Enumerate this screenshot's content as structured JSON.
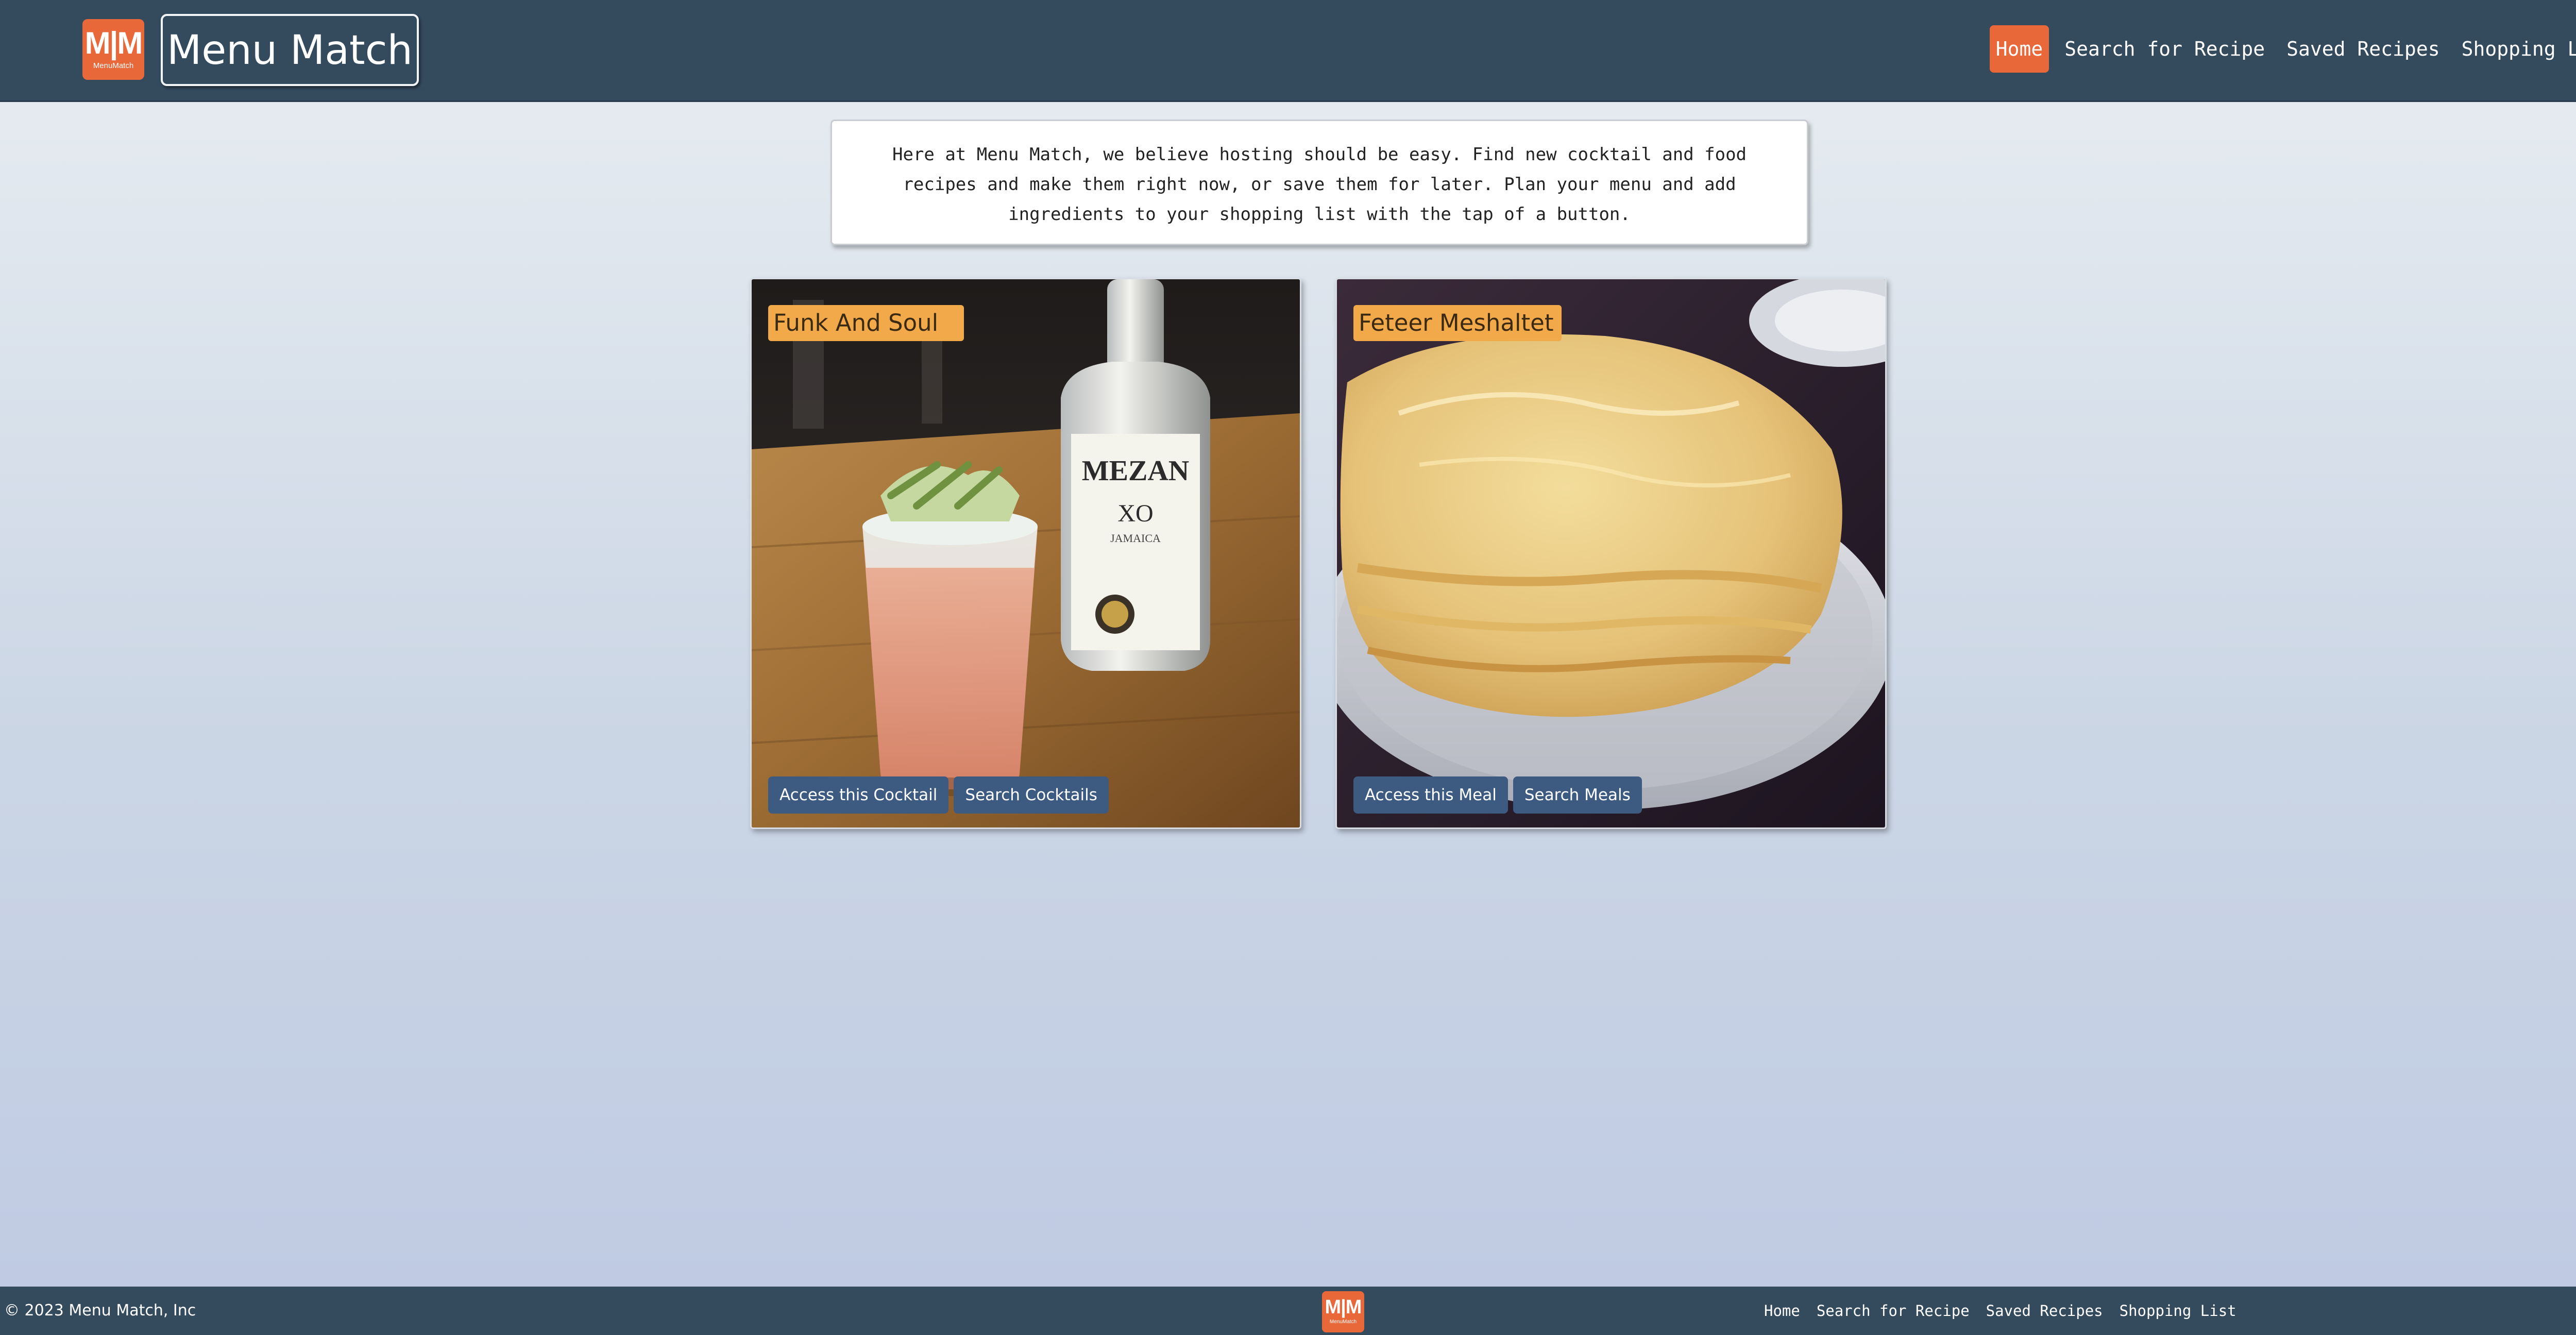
{
  "header": {
    "logo": {
      "mark": "M|M",
      "subtitle": "MenuMatch"
    },
    "title": "Menu Match",
    "nav": [
      {
        "label": "Home",
        "active": true
      },
      {
        "label": "Search for Recipe",
        "active": false
      },
      {
        "label": "Saved Recipes",
        "active": false
      },
      {
        "label": "Shopping List",
        "active": false
      }
    ]
  },
  "intro": {
    "text": "Here at Menu Match, we believe hosting should be easy. Find new cocktail and food recipes and make them right now, or save them for later. Plan your menu and add ingredients to your shopping list with the tap of a button."
  },
  "cards": [
    {
      "title": "Funk And Soul",
      "image_icon": "cocktail-photo",
      "buttons": [
        "Access this Cocktail",
        "Search Cocktails"
      ]
    },
    {
      "title": "Feteer Meshaltet",
      "image_icon": "meal-photo",
      "buttons": [
        "Access this Meal",
        "Search Meals"
      ]
    }
  ],
  "footer": {
    "copyright": "© 2023 Menu Match, Inc",
    "logo": {
      "mark": "M|M",
      "subtitle": "MenuMatch"
    },
    "nav": [
      "Home",
      "Search for Recipe",
      "Saved Recipes",
      "Shopping List"
    ]
  },
  "colors": {
    "header_bg": "#344b5e",
    "accent_orange": "#e8683a",
    "card_title_bg": "#f1a94a",
    "button_bg": "#3d5a80"
  }
}
